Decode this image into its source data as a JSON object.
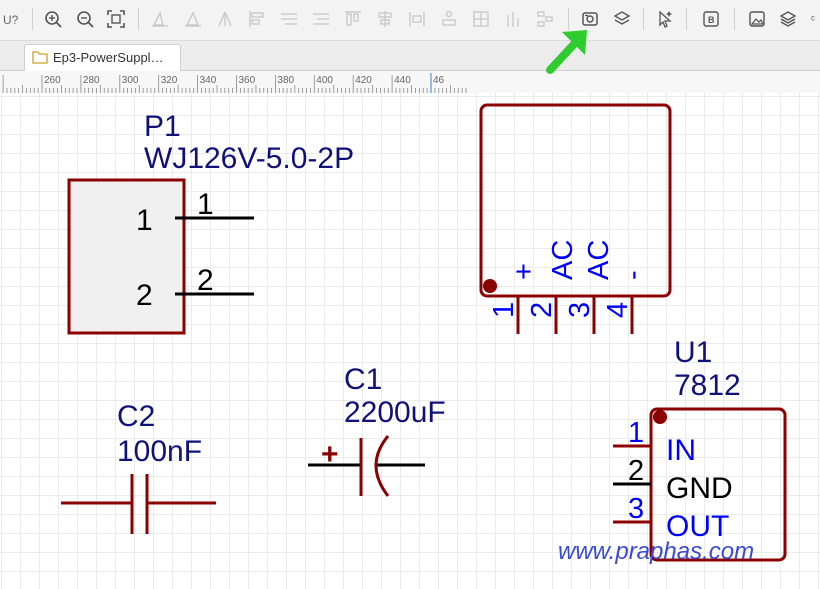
{
  "toolbar": {
    "icons": [
      "undo-icon",
      "zoom-in-icon",
      "zoom-out-icon",
      "fit-icon",
      "align-left-icon",
      "align-center-icon",
      "align-right-icon",
      "align-top-icon",
      "align-middle-icon",
      "align-bottom-icon",
      "distribute-h-icon",
      "distribute-v-icon",
      "grid-align-icon",
      "group-icon",
      "ungroup-icon",
      "toggle-pin-icon",
      "annotate-icon",
      "layers-icon",
      "cursor-sparkle-icon",
      "bom-icon",
      "image-icon",
      "layers-stack-icon",
      "more-icon"
    ]
  },
  "tab": {
    "label": "Ep3-PowerSuppl…"
  },
  "ruler": {
    "ticks": [
      "260",
      "280",
      "300",
      "320",
      "340",
      "360",
      "380",
      "400",
      "420",
      "440",
      "46"
    ]
  },
  "schematic": {
    "colors": {
      "wire": "#8b0000",
      "label": "#10107a",
      "pin": "#0000ff"
    },
    "p1": {
      "ref": "P1",
      "value": "WJ126V-5.0-2P",
      "pin1_num": "1",
      "pin1_name": "1",
      "pin2_num": "2",
      "pin2_name": "2"
    },
    "bridge": {
      "pin_names": [
        "+",
        "AC",
        "AC",
        "-"
      ],
      "pin_nums": [
        "1",
        "2",
        "3",
        "4"
      ]
    },
    "c1": {
      "ref": "C1",
      "value": "2200uF",
      "polarity": "+"
    },
    "c2": {
      "ref": "C2",
      "value": "100nF"
    },
    "u1": {
      "ref": "U1",
      "value": "7812",
      "pins": [
        {
          "num": "1",
          "name": "IN"
        },
        {
          "num": "2",
          "name": "GND"
        },
        {
          "num": "3",
          "name": "OUT"
        }
      ]
    },
    "watermark": "www.praphas.com"
  }
}
